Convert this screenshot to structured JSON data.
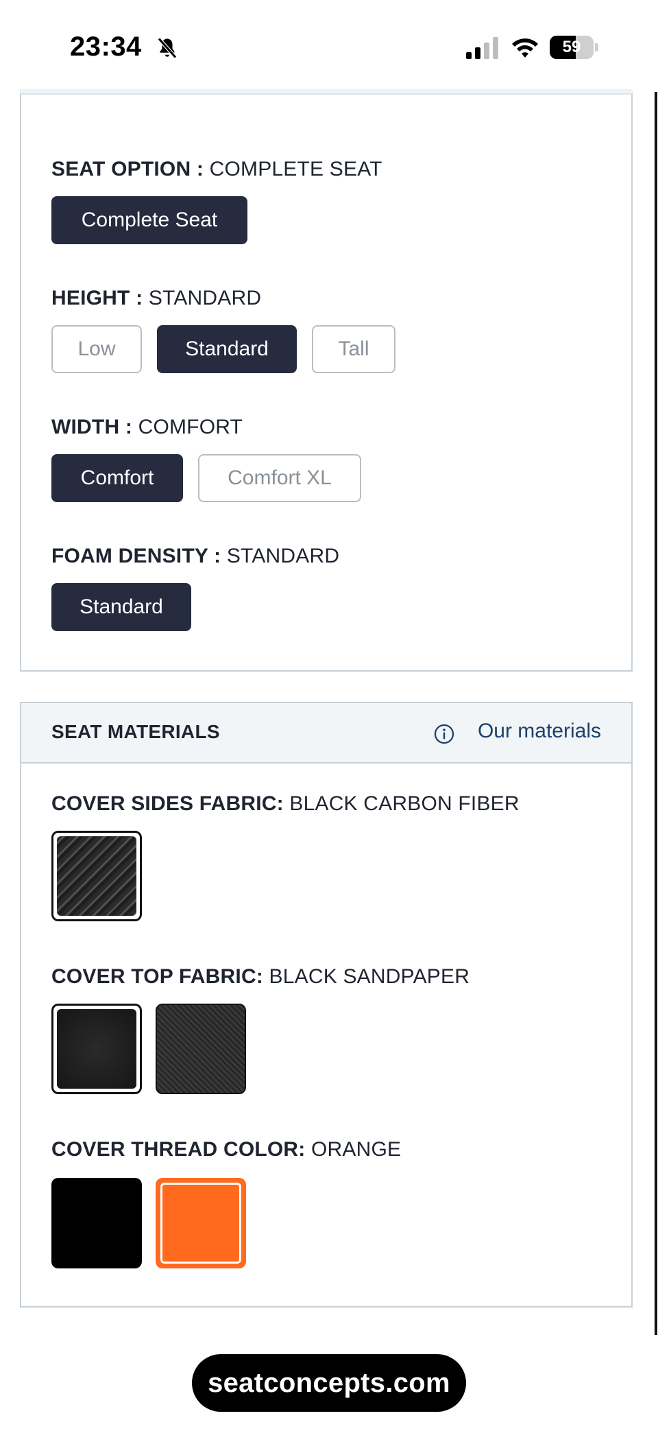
{
  "status_bar": {
    "time": "23:34",
    "battery_percent": "59",
    "battery_level": 0.59
  },
  "options": [
    {
      "label": "SEAT OPTION :",
      "value": "COMPLETE SEAT",
      "choices": [
        {
          "label": "Complete Seat",
          "selected": true
        }
      ]
    },
    {
      "label": "HEIGHT :",
      "value": "STANDARD",
      "choices": [
        {
          "label": "Low",
          "selected": false
        },
        {
          "label": "Standard",
          "selected": true
        },
        {
          "label": "Tall",
          "selected": false
        }
      ]
    },
    {
      "label": "WIDTH :",
      "value": "COMFORT",
      "choices": [
        {
          "label": "Comfort",
          "selected": true
        },
        {
          "label": "Comfort XL",
          "selected": false
        }
      ]
    },
    {
      "label": "FOAM DENSITY :",
      "value": "STANDARD",
      "choices": [
        {
          "label": "Standard",
          "selected": true
        }
      ]
    }
  ],
  "materials": {
    "title": "SEAT MATERIALS",
    "link_label": "Our materials",
    "groups": [
      {
        "label": "COVER SIDES FABRIC:",
        "value": "BLACK CARBON FIBER"
      },
      {
        "label": "COVER TOP FABRIC:",
        "value": "BLACK SANDPAPER"
      },
      {
        "label": "COVER THREAD COLOR:",
        "value": "ORANGE"
      }
    ]
  },
  "colors": {
    "selected_button": "#262b3f",
    "link": "#1d3f6b",
    "orange": "#ff6a1f",
    "border": "#c7d0d8"
  },
  "icons": [
    "bell-muted-icon",
    "signal-icon",
    "wifi-icon",
    "battery-icon",
    "info-icon"
  ],
  "footer": {
    "site": "seatconcepts.com"
  }
}
